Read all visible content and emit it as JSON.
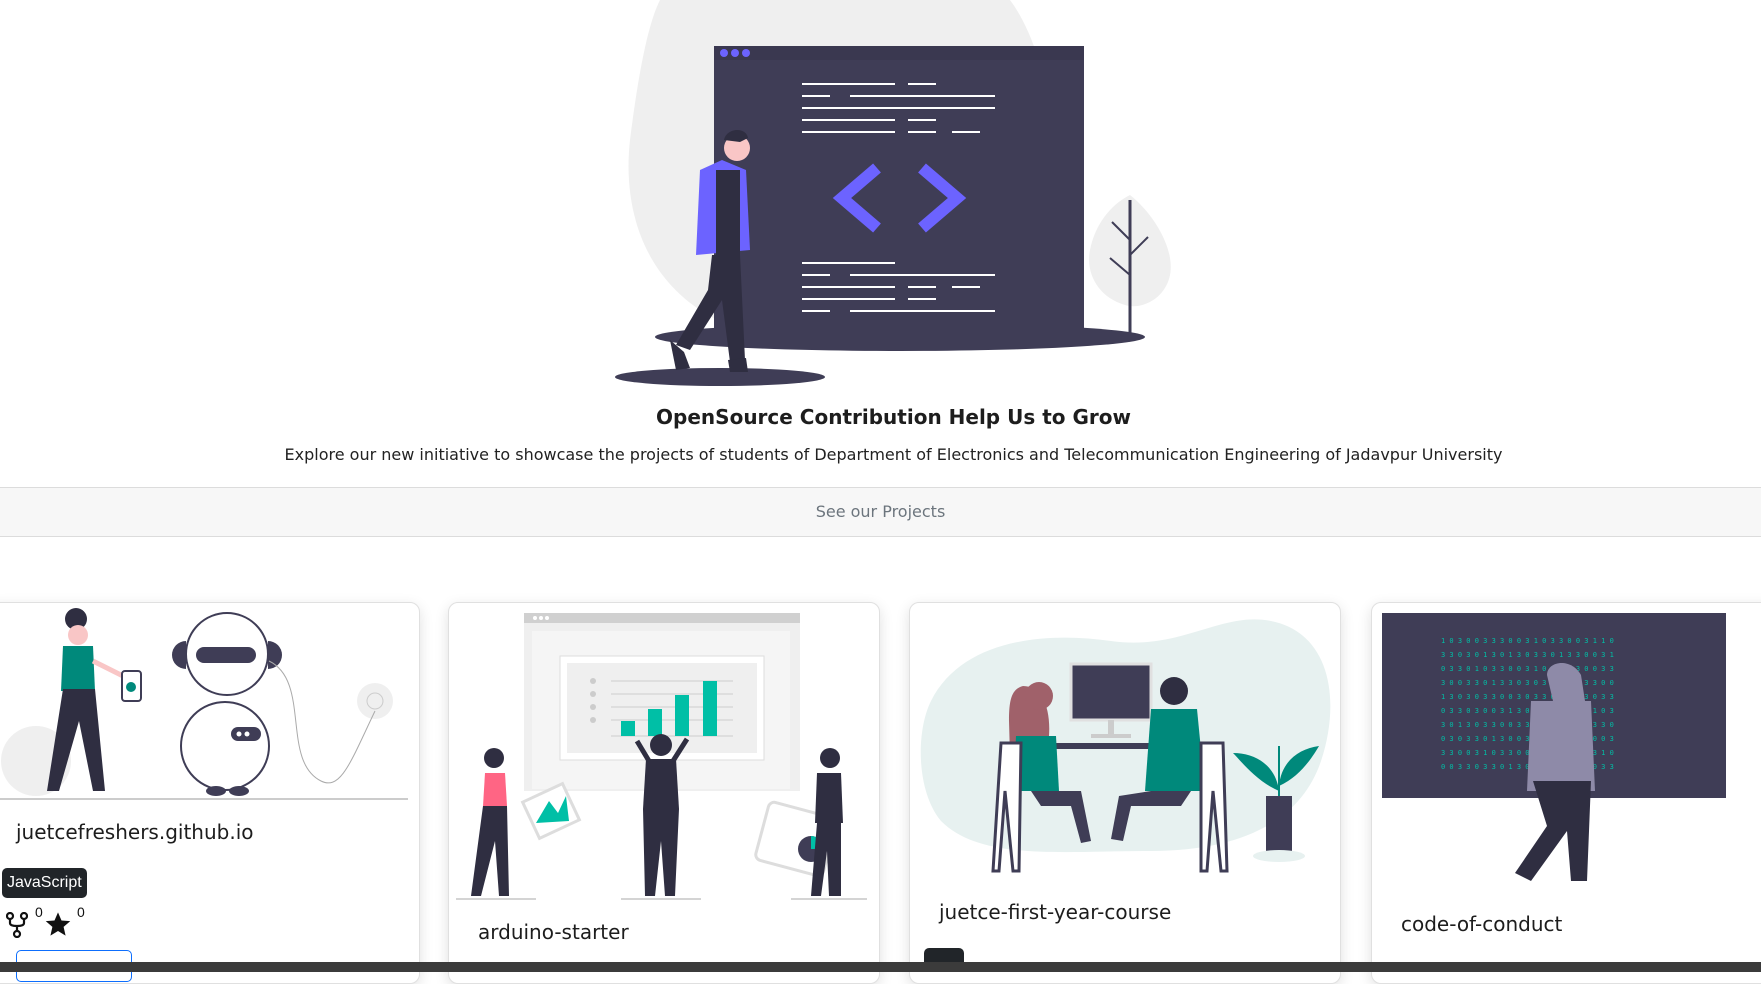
{
  "hero": {
    "title": "OpenSource Contribution Help Us to Grow",
    "subtitle": "Explore our new initiative to showcase the projects of students of Department of Electronics and Telecommunication Engineering of Jadavpur University",
    "illustration_icon": "code-window-illustration"
  },
  "projects_button": {
    "label": "See our Projects"
  },
  "cards": [
    {
      "title": "juetcefreshers.github.io",
      "language": "JavaScript",
      "forks": "0",
      "stars": "0",
      "illustration_icon": "robot-illustration"
    },
    {
      "title": "arduino-starter",
      "illustration_icon": "presentation-chart-illustration"
    },
    {
      "title": "juetce-first-year-course",
      "illustration_icon": "team-computer-illustration"
    },
    {
      "title": "code-of-conduct",
      "illustration_icon": "hooded-hacker-illustration"
    }
  ],
  "colors": {
    "accent_purple": "#6c63ff",
    "accent_teal": "#00bfa6",
    "dark_navy": "#3f3d56",
    "bar_bg": "#f7f7f7"
  }
}
